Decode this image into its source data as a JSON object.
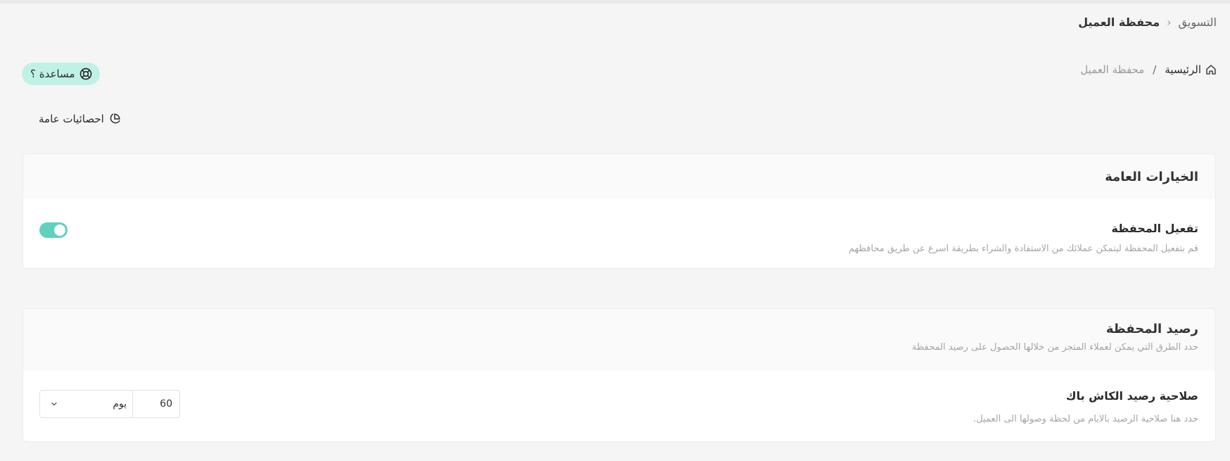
{
  "breadcrumb_top": {
    "section": "التسويق",
    "current": "محفظة العميل"
  },
  "breadcrumb_page": {
    "home": "الرئيسية",
    "separator": "/",
    "current": "محفظة العميل"
  },
  "help": {
    "label": "مساعدة ؟"
  },
  "stats_link": {
    "label": "احصائيات عامة"
  },
  "general_options": {
    "title": "الخيارات العامة",
    "wallet_toggle": {
      "title": "تفعيل المحفظة",
      "description": "قم بتفعيل المحفظة ليتمكن عملائك من الاستفادة والشراء بطريقة اسرع عن طريق محافظهم",
      "enabled": true
    }
  },
  "wallet_balance": {
    "title": "رصيد المحفظة",
    "description": "حدد الطرق التي يمكن لعملاء المتجر من خلالها الحصول على رصيد المحفظة",
    "cashback_validity": {
      "title": "صلاحية رصيد الكاش باك",
      "description": "حدد هنا صلاحية الرصيد بالايام من لحظة وصولها الى العميل.",
      "value": "60",
      "unit": "يوم"
    }
  },
  "colors": {
    "accent": "#5ed2bd",
    "help_bg": "#bff2e7"
  }
}
